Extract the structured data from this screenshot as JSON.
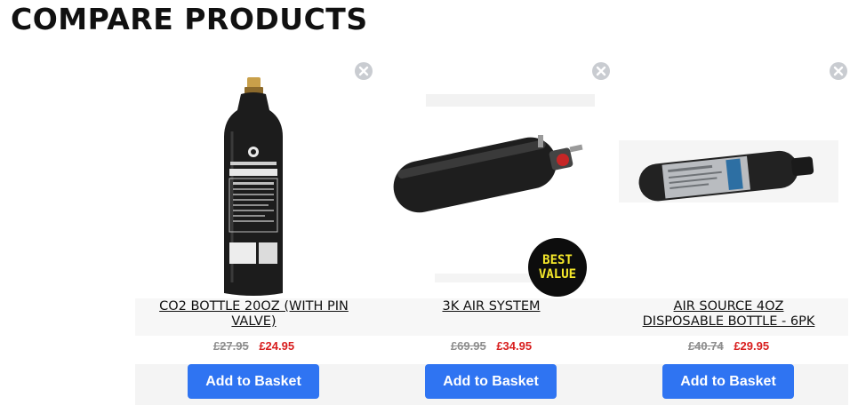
{
  "page": {
    "title": "COMPARE PRODUCTS"
  },
  "colors": {
    "accent_button": "#2f74f2",
    "sale_price": "#d81e1e",
    "old_price": "#8d8d8d",
    "badge_bg": "#0d0d0d",
    "badge_text": "#f5e82a"
  },
  "products": [
    {
      "name_line1": "CO2 BOTTLE 20OZ (WITH PIN",
      "name_line2": "VALVE)",
      "old_price": "£27.95",
      "price": "£24.95",
      "button_label": "Add to Basket",
      "remove_icon": "remove-x-icon"
    },
    {
      "name_line1": "3K AIR SYSTEM",
      "name_line2": "",
      "old_price": "£69.95",
      "price": "£34.95",
      "button_label": "Add to Basket",
      "remove_icon": "remove-x-icon",
      "badge_line1": "BEST",
      "badge_line2": "VALUE"
    },
    {
      "name_line1": "AIR SOURCE 4OZ",
      "name_line2": "DISPOSABLE BOTTLE - 6PK",
      "old_price": "£40.74",
      "price": "£29.95",
      "button_label": "Add to Basket",
      "remove_icon": "remove-x-icon"
    }
  ]
}
